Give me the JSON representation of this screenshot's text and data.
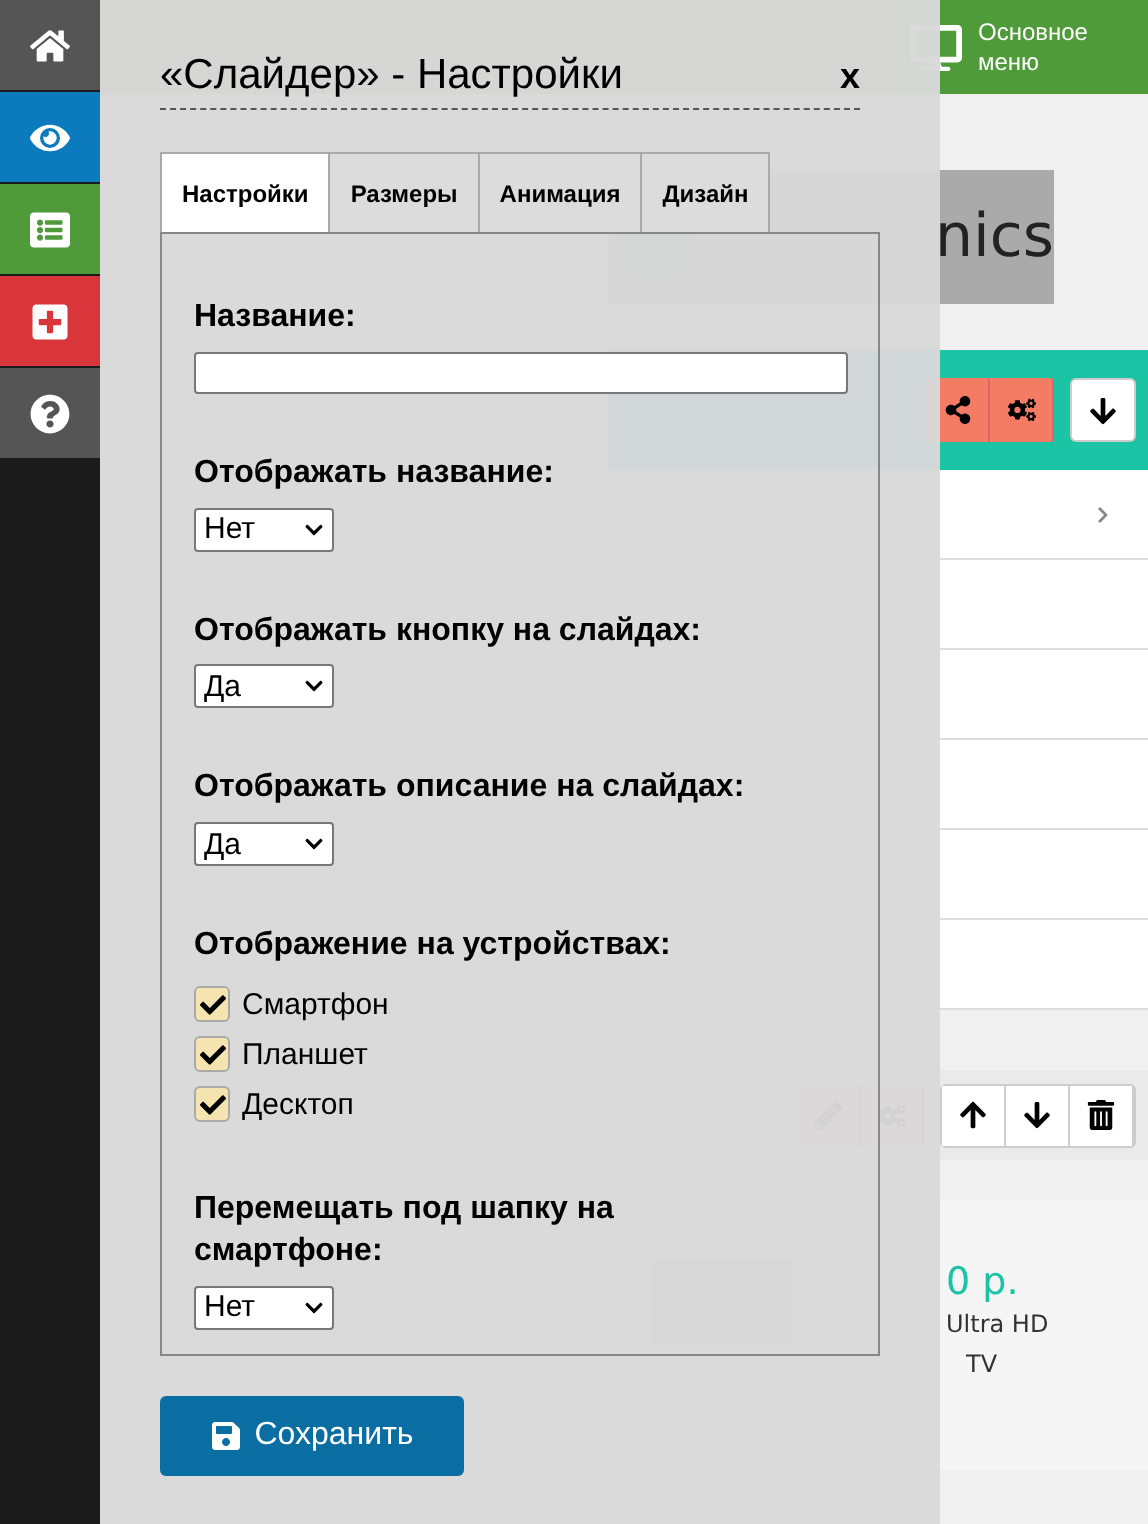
{
  "sidebar": {
    "items": [
      {
        "kind": "home",
        "color": "#555555"
      },
      {
        "kind": "eye",
        "color": "#0c7bbd"
      },
      {
        "kind": "list",
        "color": "#4f9a39"
      },
      {
        "kind": "plus",
        "color": "#d8363b"
      },
      {
        "kind": "help",
        "color": "#555555"
      }
    ]
  },
  "top_bar": {
    "active_item": {
      "lines": [
        "Основное",
        "меню"
      ]
    }
  },
  "store": {
    "logo_fragment": "nics",
    "price_fragment": "0 р.",
    "name_fragments": [
      "Ultra HD",
      "TV"
    ]
  },
  "dialog": {
    "title": "«Слайдер» - Настройки",
    "close": "x",
    "tabs": [
      {
        "label": "Настройки",
        "selected": true
      },
      {
        "label": "Размеры",
        "selected": false
      },
      {
        "label": "Анимация",
        "selected": false
      },
      {
        "label": "Дизайн",
        "selected": false
      }
    ],
    "fields": [
      {
        "kind": "text",
        "label": "Название:"
      },
      {
        "kind": "select",
        "label": "Отображать название:",
        "value": "Нет"
      },
      {
        "kind": "select",
        "label": "Отображать кнопку на слайдах:",
        "value": "Да"
      },
      {
        "kind": "select",
        "label": "Отображать описание на слайдах:",
        "value": "Да"
      },
      {
        "kind": "checkboxes",
        "label": "Отображение на устройствах:",
        "options": [
          {
            "label": "Смартфон",
            "checked": true
          },
          {
            "label": "Планшет",
            "checked": true
          },
          {
            "label": "Десктоп",
            "checked": true
          }
        ]
      },
      {
        "kind": "select",
        "label": "Перемещать под шапку на смартфоне:",
        "value": "Нет"
      }
    ],
    "save_button": "Сохранить"
  }
}
